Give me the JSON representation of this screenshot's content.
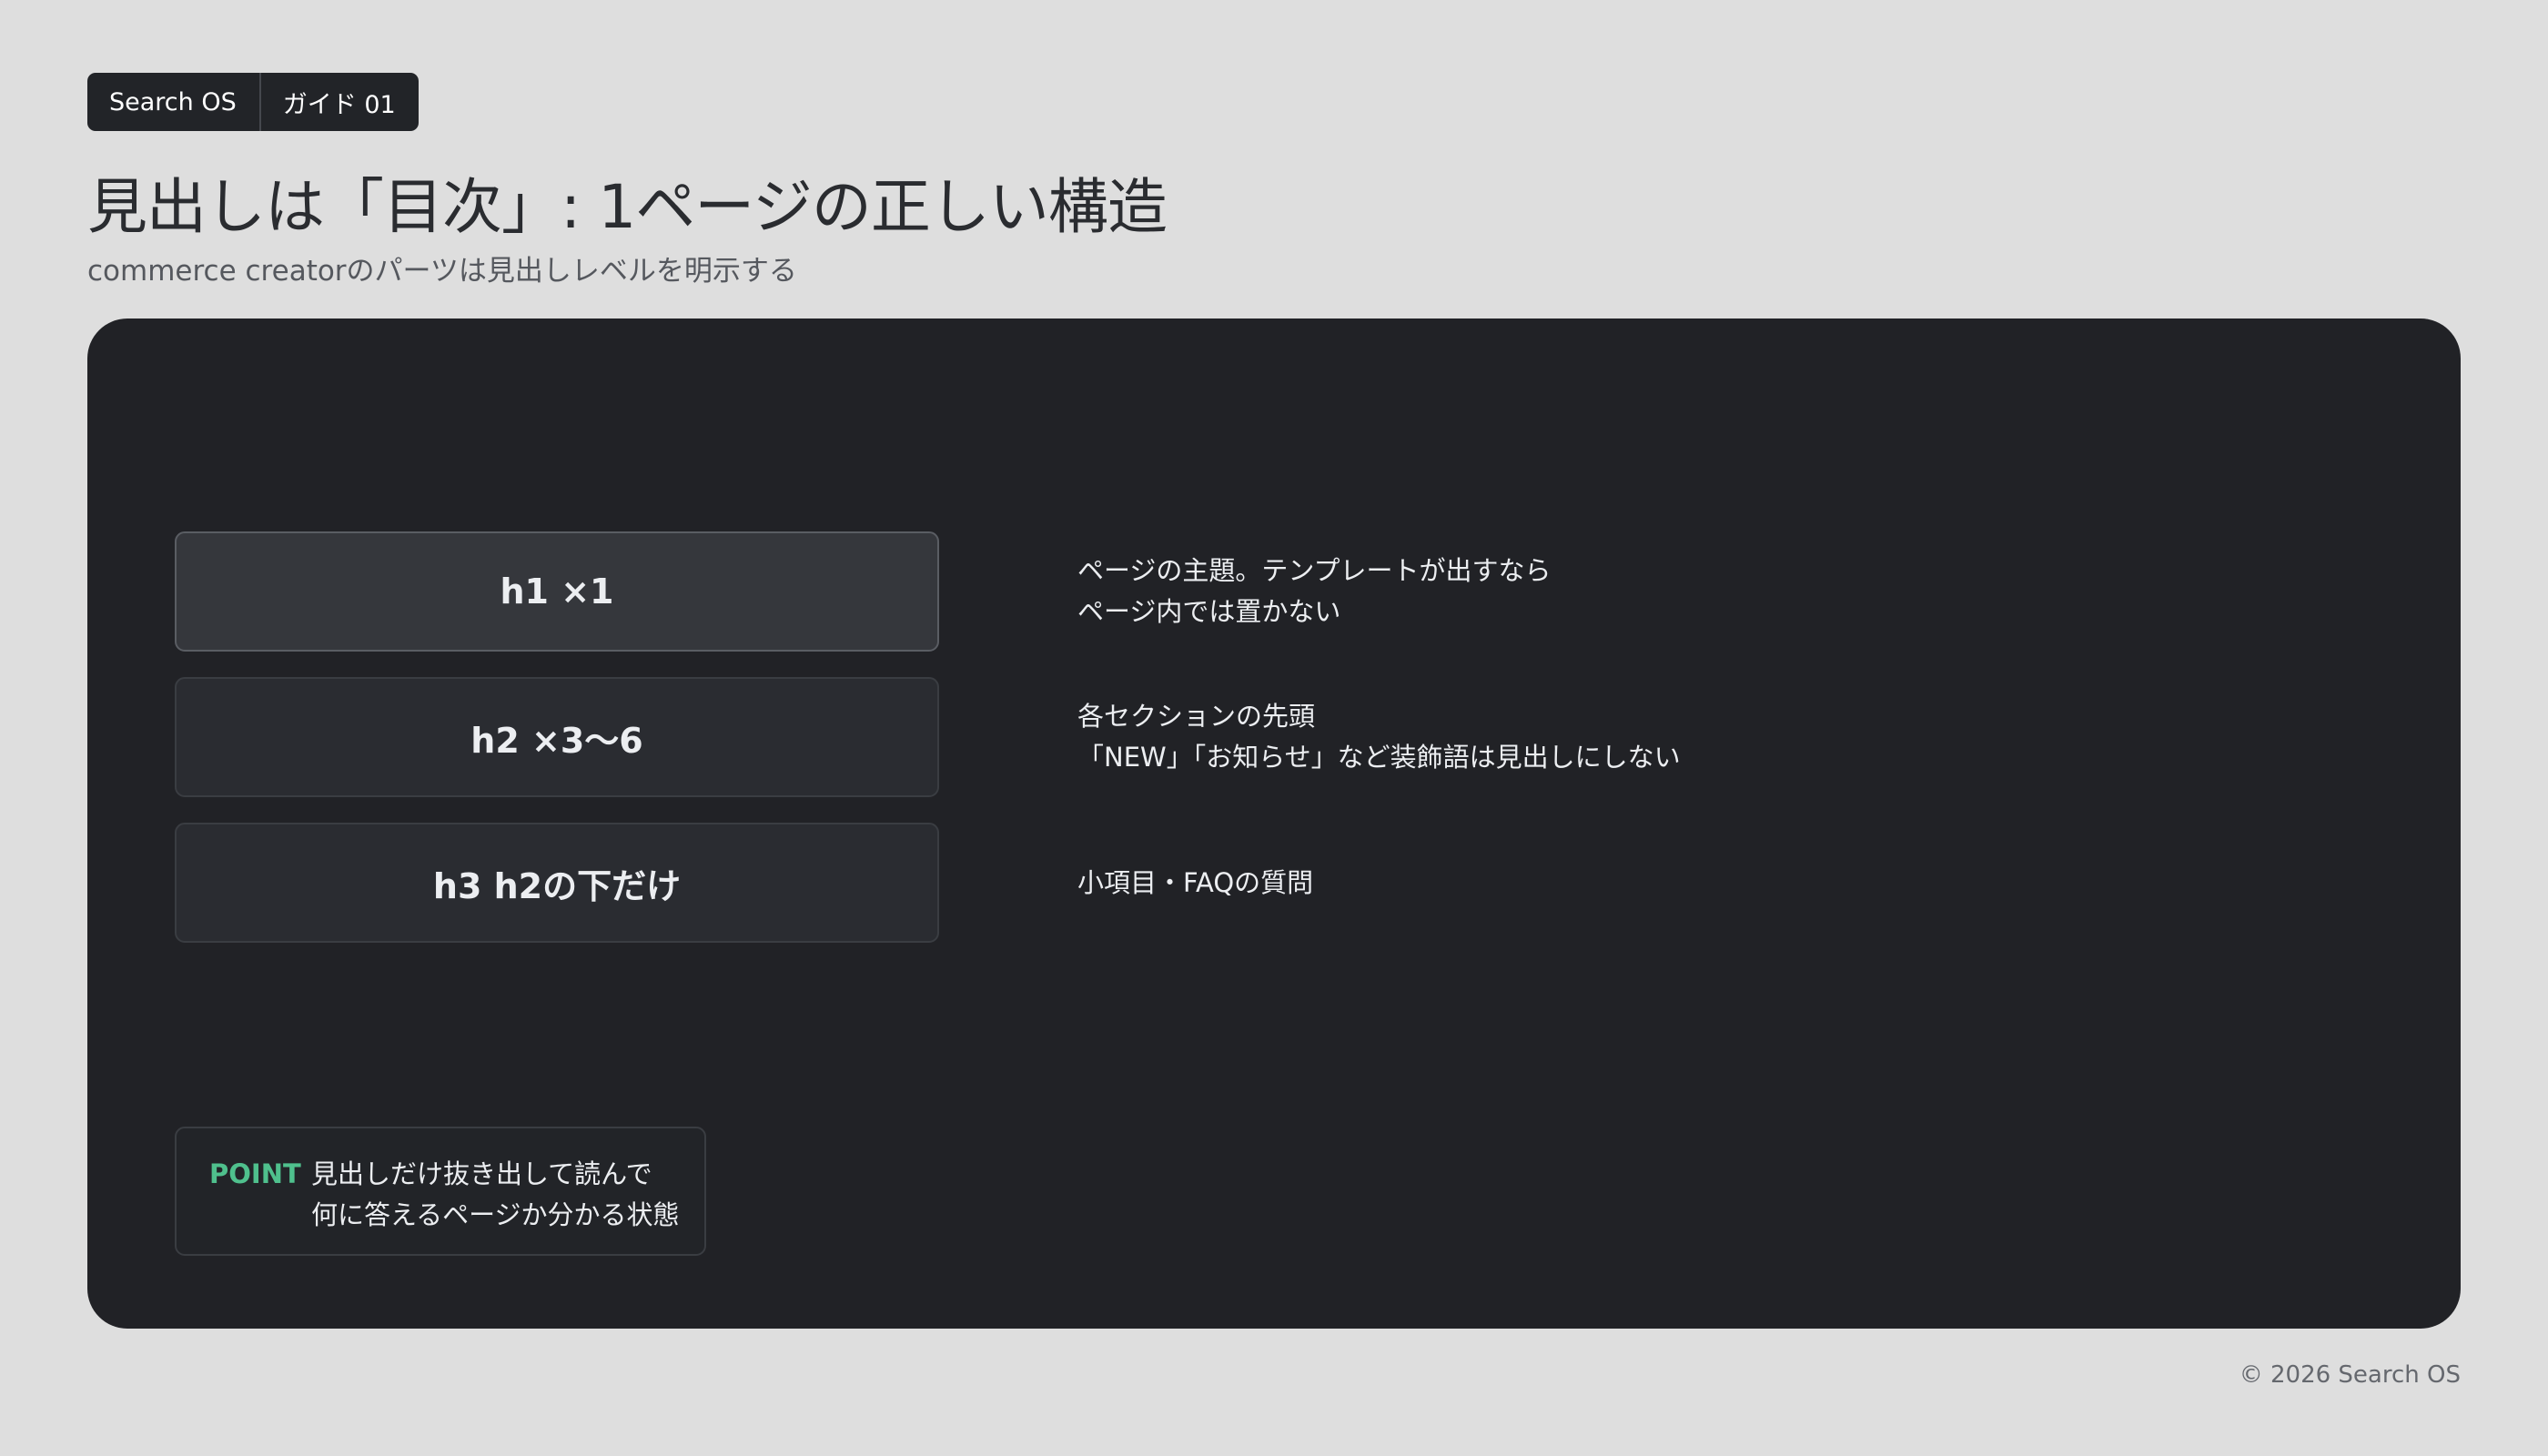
{
  "badge": {
    "brand": "Search OS",
    "guide": "ガイド 01"
  },
  "header": {
    "title": "見出しは「目次」: 1ページの正しい構造",
    "subtitle": "commerce creatorのパーツは見出しレベルを明示する"
  },
  "levels": [
    {
      "label": "h1 ×1",
      "highlighted": true,
      "desc_lines": [
        "ページの主題。テンプレートが出すなら",
        "ページ内では置かない"
      ]
    },
    {
      "label": "h2 ×3〜6",
      "highlighted": false,
      "desc_lines": [
        "各セクションの先頭",
        "「NEW」「お知らせ」など装飾語は見出しにしない"
      ]
    },
    {
      "label": "h3 h2の下だけ",
      "highlighted": false,
      "desc_lines": [
        "小項目・FAQの質問"
      ]
    }
  ],
  "point": {
    "label": "POINT",
    "lines": [
      "見出しだけ抜き出して読んで",
      "何に答えるページか分かる状態"
    ]
  },
  "footer": {
    "copyright": "© 2026 Search OS"
  },
  "colors": {
    "page_background": "#dedede",
    "panel_background": "#212226",
    "point_accent": "#4fc08d"
  }
}
